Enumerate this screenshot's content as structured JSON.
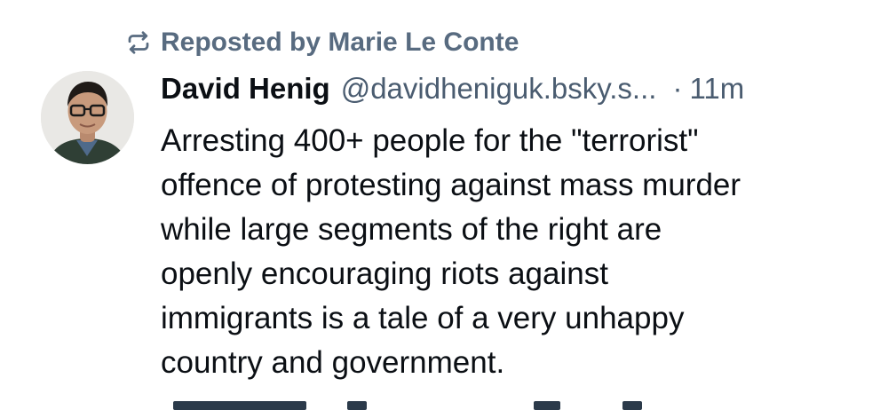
{
  "repost": {
    "label": "Reposted by Marie Le Conte",
    "icon": "repost-icon",
    "color": "#586b80"
  },
  "post": {
    "author": {
      "name": "David Henig",
      "handle": "@davidheniguk.bsky.s...",
      "avatar_icon": "avatar-photo"
    },
    "separator": "·",
    "timestamp": "11m",
    "text_lines": [
      "Arresting 400+ people for the \"terrorist\"",
      "offence of protesting against mass murder",
      "while large segments of the right are",
      "openly encouraging riots against",
      "immigrants is a tale of a very unhappy",
      "country and government."
    ]
  },
  "colors": {
    "text": "#0b0f14",
    "muted": "#4a5c70",
    "background": "#ffffff"
  }
}
